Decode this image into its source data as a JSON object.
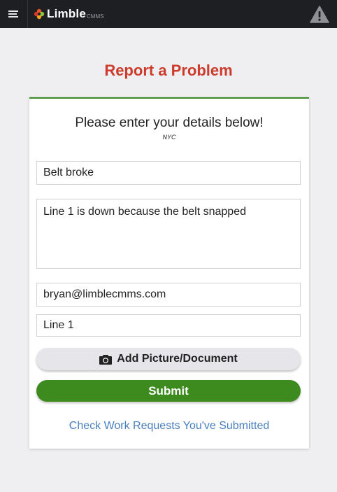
{
  "header": {
    "logo_text": "Limble",
    "logo_sub": "CMMS",
    "menu_icon": "hamburger-menu-icon",
    "alert_icon": "warning-triangle-icon"
  },
  "page": {
    "title": "Report a Problem"
  },
  "form": {
    "heading": "Please enter your details below!",
    "location_tag": "NYC",
    "title_value": "Belt broke",
    "description_value": "Line 1 is down because the belt snapped",
    "email_value": "bryan@limblecmms.com",
    "location_value": "Line 1",
    "add_picture_label": "Add Picture/Document",
    "submit_label": "Submit",
    "check_requests_label": "Check Work Requests You've Submitted"
  },
  "colors": {
    "brand_red": "#cc3b2c",
    "submit_green": "#3d8a1f",
    "link_blue": "#4a7fc0",
    "topbar": "#1e1f22"
  }
}
